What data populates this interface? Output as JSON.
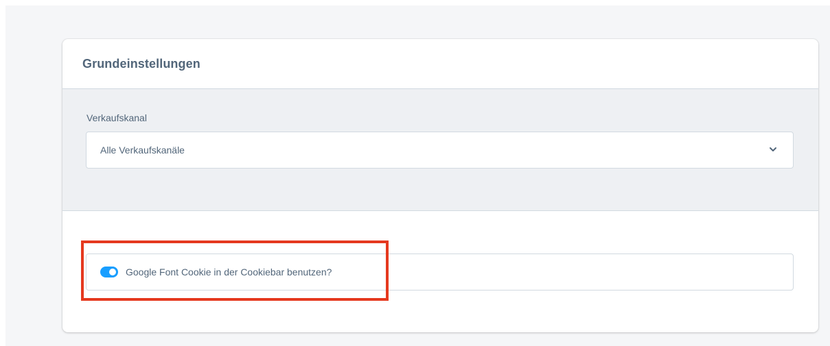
{
  "card": {
    "title": "Grundeinstellungen"
  },
  "sales_channel": {
    "label": "Verkaufskanal",
    "selected": "Alle Verkaufskanäle",
    "icon": "chevron-down-icon"
  },
  "google_font_toggle": {
    "label": "Google Font Cookie in der Cookiebar benutzen?",
    "enabled": true,
    "color": "#189eff"
  },
  "annotation": {
    "highlight_color": "#e5391f"
  }
}
